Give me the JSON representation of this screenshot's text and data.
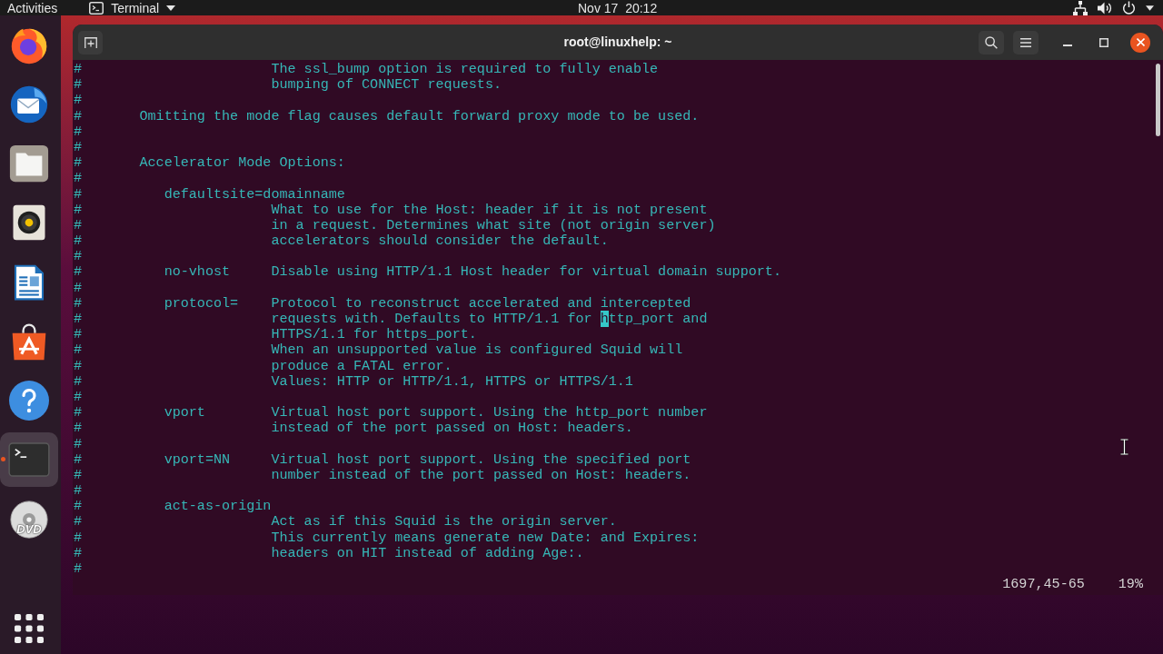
{
  "top_bar": {
    "activities": "Activities",
    "app_menu": "Terminal",
    "clock": "Nov 17  20:12"
  },
  "dock": {
    "items": [
      {
        "kind": "browser",
        "selected": false,
        "running": false
      },
      {
        "kind": "mail",
        "selected": false,
        "running": false
      },
      {
        "kind": "files",
        "selected": false,
        "running": false
      },
      {
        "kind": "music",
        "selected": false,
        "running": false
      },
      {
        "kind": "writer",
        "selected": false,
        "running": false
      },
      {
        "kind": "software",
        "selected": false,
        "running": false
      },
      {
        "kind": "help",
        "selected": false,
        "running": false
      },
      {
        "kind": "terminal",
        "selected": true,
        "running": true
      },
      {
        "kind": "disc",
        "label": "DVD",
        "selected": false,
        "running": false
      }
    ]
  },
  "window": {
    "title": "root@linuxhelp: ~"
  },
  "terminal": {
    "lines": [
      {
        "text": "#                       The ssl_bump option is required to fully enable"
      },
      {
        "text": "#                       bumping of CONNECT requests."
      },
      {
        "text": "#"
      },
      {
        "text": "#       Omitting the mode flag causes default forward proxy mode to be used."
      },
      {
        "text": "#"
      },
      {
        "text": "#"
      },
      {
        "text": "#       Accelerator Mode Options:"
      },
      {
        "text": "#"
      },
      {
        "text": "#          defaultsite=domainname"
      },
      {
        "text": "#                       What to use for the Host: header if it is not present"
      },
      {
        "text": "#                       in a request. Determines what site (not origin server)"
      },
      {
        "text": "#                       accelerators should consider the default."
      },
      {
        "text": "#"
      },
      {
        "text": "#          no-vhost     Disable using HTTP/1.1 Host header for virtual domain support."
      },
      {
        "text": "#"
      },
      {
        "text": "#          protocol=    Protocol to reconstruct accelerated and intercepted"
      },
      {
        "parts": [
          {
            "text": "#                       requests with. Defaults to HTTP/1.1 for ",
            "cursor": false
          },
          {
            "text": "h",
            "cursor": true
          },
          {
            "text": "ttp_port and",
            "cursor": false
          }
        ]
      },
      {
        "text": "#                       HTTPS/1.1 for https_port."
      },
      {
        "text": "#                       When an unsupported value is configured Squid will"
      },
      {
        "text": "#                       produce a FATAL error."
      },
      {
        "text": "#                       Values: HTTP or HTTP/1.1, HTTPS or HTTPS/1.1"
      },
      {
        "text": "#"
      },
      {
        "text": "#          vport        Virtual host port support. Using the http_port number"
      },
      {
        "text": "#                       instead of the port passed on Host: headers."
      },
      {
        "text": "#"
      },
      {
        "text": "#          vport=NN     Virtual host port support. Using the specified port"
      },
      {
        "text": "#                       number instead of the port passed on Host: headers."
      },
      {
        "text": "#"
      },
      {
        "text": "#          act-as-origin"
      },
      {
        "text": "#                       Act as if this Squid is the origin server."
      },
      {
        "text": "#                       This currently means generate new Date: and Expires:"
      },
      {
        "text": "#                       headers on HIT instead of adding Age:."
      },
      {
        "text": "#"
      }
    ],
    "status": {
      "position": "1697,45-65",
      "percent": "19%"
    }
  }
}
